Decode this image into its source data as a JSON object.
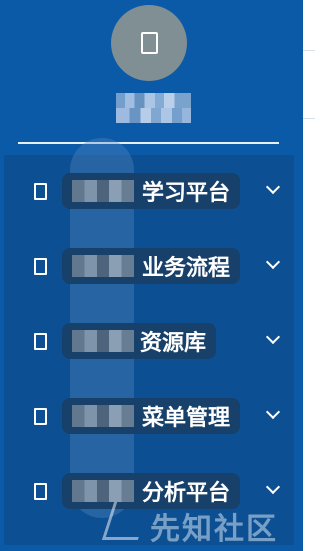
{
  "sidebar": {
    "avatar_icon": "user-icon",
    "username": "",
    "menu": [
      {
        "label": "学习平台",
        "icon": "document-icon",
        "expand_icon": "chevron-down-icon"
      },
      {
        "label": "业务流程",
        "icon": "document-icon",
        "expand_icon": "chevron-down-icon"
      },
      {
        "label": "资源库",
        "icon": "document-icon",
        "expand_icon": "chevron-down-icon"
      },
      {
        "label": "菜单管理",
        "icon": "document-icon",
        "expand_icon": "chevron-down-icon"
      },
      {
        "label": "分析平台",
        "icon": "document-icon",
        "expand_icon": "chevron-down-icon"
      }
    ]
  },
  "watermark": {
    "text": "先知社区"
  },
  "colors": {
    "sidebar_bg": "#0b5aa8",
    "menu_panel_bg": "#0c4f93",
    "label_pill_bg": "#17406b",
    "avatar_bg": "#7f8f93",
    "text": "#ffffff"
  }
}
